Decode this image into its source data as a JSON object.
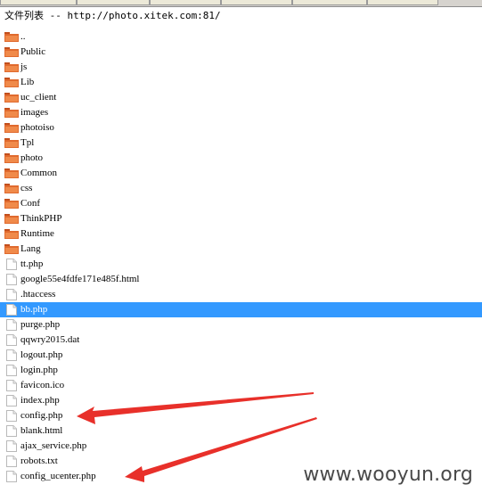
{
  "header": {
    "title": "文件列表 -- http://photo.xitek.com:81/"
  },
  "files": [
    {
      "name": "..",
      "type": "folder"
    },
    {
      "name": "Public",
      "type": "folder"
    },
    {
      "name": "js",
      "type": "folder"
    },
    {
      "name": "Lib",
      "type": "folder"
    },
    {
      "name": "uc_client",
      "type": "folder"
    },
    {
      "name": "images",
      "type": "folder"
    },
    {
      "name": "photoiso",
      "type": "folder"
    },
    {
      "name": "Tpl",
      "type": "folder"
    },
    {
      "name": "photo",
      "type": "folder"
    },
    {
      "name": "Common",
      "type": "folder"
    },
    {
      "name": "css",
      "type": "folder"
    },
    {
      "name": "Conf",
      "type": "folder"
    },
    {
      "name": "ThinkPHP",
      "type": "folder"
    },
    {
      "name": "Runtime",
      "type": "folder"
    },
    {
      "name": "Lang",
      "type": "folder"
    },
    {
      "name": "tt.php",
      "type": "file"
    },
    {
      "name": "google55e4fdfe171e485f.html",
      "type": "file"
    },
    {
      "name": ".htaccess",
      "type": "file"
    },
    {
      "name": "bb.php",
      "type": "file",
      "selected": true
    },
    {
      "name": "purge.php",
      "type": "file"
    },
    {
      "name": "qqwry2015.dat",
      "type": "file"
    },
    {
      "name": "logout.php",
      "type": "file"
    },
    {
      "name": "login.php",
      "type": "file"
    },
    {
      "name": "favicon.ico",
      "type": "file"
    },
    {
      "name": "index.php",
      "type": "file"
    },
    {
      "name": "config.php",
      "type": "file"
    },
    {
      "name": "blank.html",
      "type": "file"
    },
    {
      "name": "ajax_service.php",
      "type": "file"
    },
    {
      "name": "robots.txt",
      "type": "file"
    },
    {
      "name": "config_ucenter.php",
      "type": "file"
    }
  ],
  "annotations": {
    "arrow_color": "#e8302a",
    "points_to": [
      "config.php",
      "config_ucenter.php"
    ]
  },
  "watermark": {
    "text": "www.wooyun.org"
  },
  "colors": {
    "selection": "#3399ff",
    "folder": "#d9632a"
  }
}
